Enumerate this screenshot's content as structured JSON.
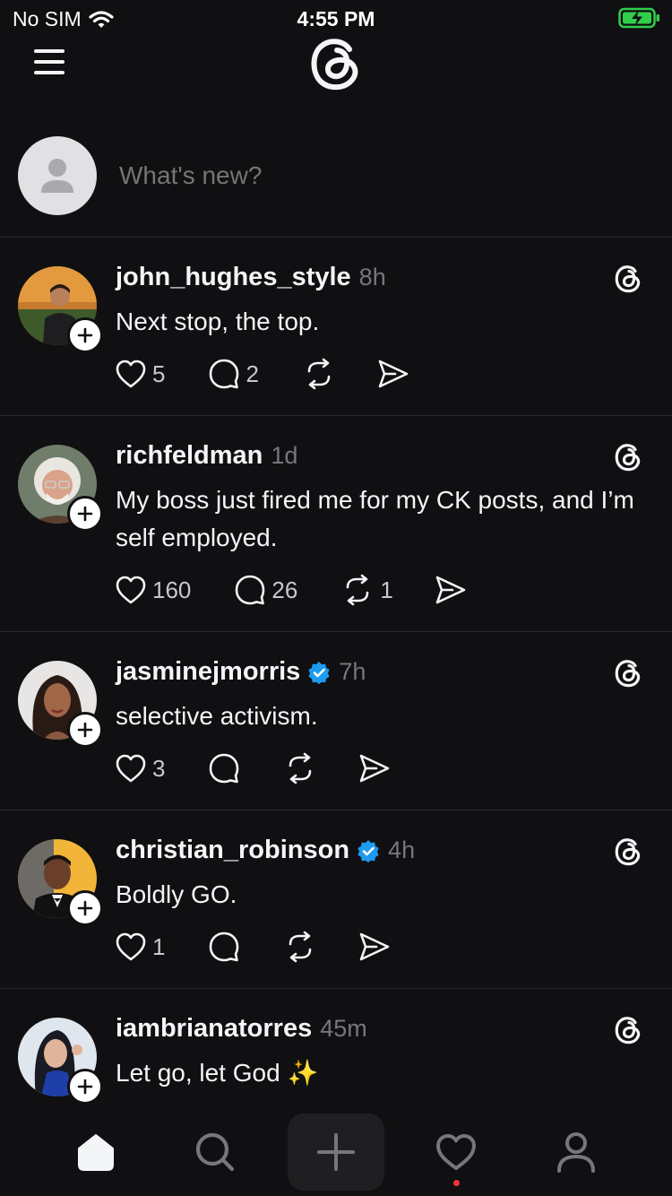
{
  "status_bar": {
    "carrier": "No SIM",
    "time": "4:55 PM",
    "battery_color": "#2fcf4a"
  },
  "composer": {
    "placeholder": "What's new?"
  },
  "posts": [
    {
      "username": "john_hughes_style",
      "time": "8h",
      "verified": false,
      "text": "Next stop, the top.",
      "likes": "5",
      "replies": "2",
      "reposts": ""
    },
    {
      "username": "richfeldman",
      "time": "1d",
      "verified": false,
      "text": "My boss just fired me for my CK posts, and I’m self employed.",
      "likes": "160",
      "replies": "26",
      "reposts": "1"
    },
    {
      "username": "jasminejmorris",
      "time": "7h",
      "verified": true,
      "text": "selective activism.",
      "likes": "3",
      "replies": "",
      "reposts": ""
    },
    {
      "username": "christian_robinson",
      "time": "4h",
      "verified": true,
      "text": "Boldly GO.",
      "likes": "1",
      "replies": "",
      "reposts": ""
    },
    {
      "username": "iambrianatorres",
      "time": "45m",
      "verified": false,
      "text": "Let go, let God ✨",
      "likes": "",
      "replies": "",
      "reposts": ""
    }
  ],
  "nav": {
    "items": [
      "home-icon",
      "search-icon",
      "create-icon",
      "activity-icon",
      "profile-icon"
    ],
    "activity_dot_color": "#ff3040",
    "verified_color": "#1d9bf0"
  }
}
